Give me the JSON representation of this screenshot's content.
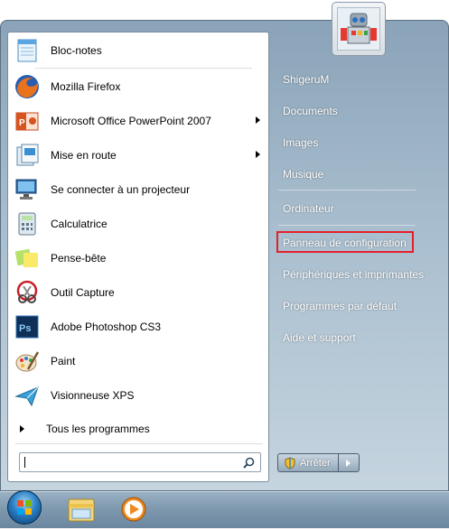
{
  "pinned_programs": [
    {
      "label": "Bloc-notes",
      "icon": "notepad-icon",
      "has_submenu": false
    },
    {
      "label": "Mozilla Firefox",
      "icon": "firefox-icon",
      "has_submenu": false
    },
    {
      "label": "Microsoft Office PowerPoint 2007",
      "icon": "powerpoint-icon",
      "has_submenu": true
    },
    {
      "label": "Mise en route",
      "icon": "getting-started-icon",
      "has_submenu": true
    },
    {
      "label": "Se connecter à un projecteur",
      "icon": "projector-icon",
      "has_submenu": false
    },
    {
      "label": "Calculatrice",
      "icon": "calculator-icon",
      "has_submenu": false
    },
    {
      "label": "Pense-bête",
      "icon": "sticky-notes-icon",
      "has_submenu": false
    },
    {
      "label": "Outil Capture",
      "icon": "snipping-tool-icon",
      "has_submenu": false
    },
    {
      "label": "Adobe Photoshop CS3",
      "icon": "photoshop-icon",
      "has_submenu": false
    },
    {
      "label": "Paint",
      "icon": "paint-icon",
      "has_submenu": false
    },
    {
      "label": "Visionneuse XPS",
      "icon": "xps-viewer-icon",
      "has_submenu": false
    }
  ],
  "all_programs_label": "Tous les programmes",
  "search": {
    "value": "",
    "placeholder": ""
  },
  "right_pane": {
    "user": "ShigeruM",
    "documents": "Documents",
    "images": "Images",
    "music": "Musique",
    "computer": "Ordinateur",
    "control_panel": "Panneau de configuration",
    "devices": "Périphériques et imprimantes",
    "default_programs": "Programmes par défaut",
    "help": "Aide et support"
  },
  "shutdown_label": "Arrêter",
  "highlight_color": "#e4202b",
  "taskbar": {
    "items": [
      "start-orb",
      "explorer-icon",
      "media-player-icon"
    ]
  }
}
